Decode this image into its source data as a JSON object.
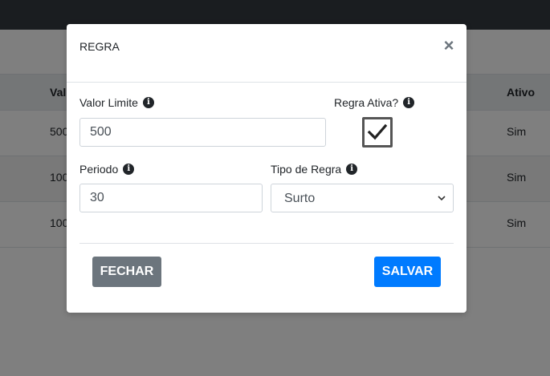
{
  "background_table": {
    "headers": {
      "valor": "Val",
      "ativo": "Ativo"
    },
    "rows": [
      {
        "valor": "500",
        "ativo": "Sim"
      },
      {
        "valor": "100",
        "ativo": "Sim"
      },
      {
        "valor": "100",
        "ativo": "Sim"
      }
    ]
  },
  "modal": {
    "title": "REGRA",
    "close_glyph": "×",
    "fields": {
      "valor_limite": {
        "label": "Valor Limite",
        "value": "500"
      },
      "regra_ativa": {
        "label": "Regra Ativa?",
        "checked": true
      },
      "periodo": {
        "label": "Periodo",
        "value": "30"
      },
      "tipo_regra": {
        "label": "Tipo de Regra",
        "selected": "Surto"
      }
    },
    "info_glyph": "i",
    "buttons": {
      "close": "FECHAR",
      "save": "SALVAR"
    }
  },
  "colors": {
    "topbar": "#343a40",
    "primary": "#007bff",
    "secondary": "#6c757d"
  }
}
